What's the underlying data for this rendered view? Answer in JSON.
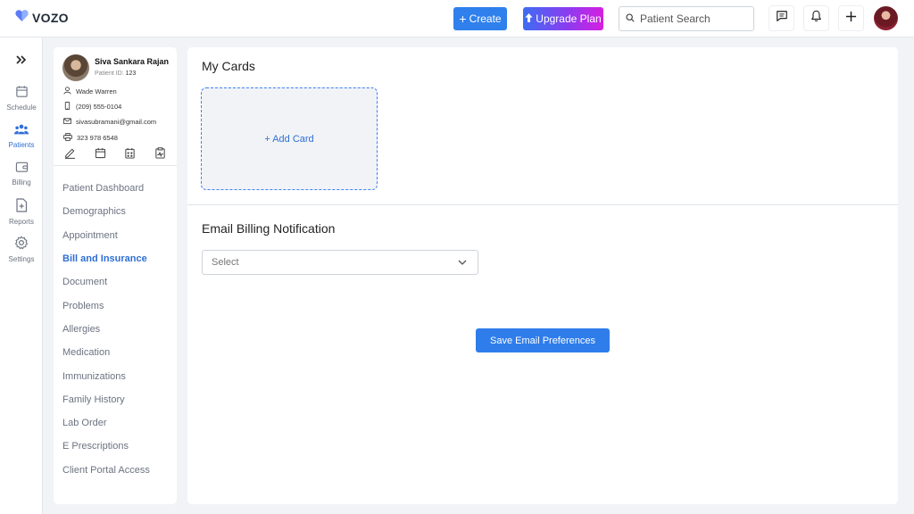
{
  "app": {
    "logo_text": "VOZO"
  },
  "header": {
    "create_label": "Create",
    "upgrade_label": "Upgrade Plan",
    "search_placeholder": "Patient Search"
  },
  "leftnav": {
    "items": [
      {
        "label": "Schedule",
        "icon": "calendar-icon"
      },
      {
        "label": "Patients",
        "icon": "patients-icon",
        "active": true
      },
      {
        "label": "Billing",
        "icon": "wallet-icon"
      },
      {
        "label": "Reports",
        "icon": "report-icon"
      },
      {
        "label": "Settings",
        "icon": "gear-icon"
      }
    ]
  },
  "patient": {
    "name": "Siva Sankara Rajan",
    "id_label": "Patient ID:",
    "id_value": "123",
    "provider": "Wade Warren",
    "phone": "(209) 555-0104",
    "email": "sivasubramani@gmail.com",
    "fax": "323 978 6548"
  },
  "patient_menu": {
    "items": [
      "Patient Dashboard",
      "Demographics",
      "Appointment",
      "Bill and Insurance",
      "Document",
      "Problems",
      "Allergies",
      "Medication",
      "Immunizations",
      "Family History",
      "Lab Order",
      "E Prescriptions",
      "Client Portal Access"
    ],
    "active": "Bill and Insurance"
  },
  "main": {
    "cards_title": "My Cards",
    "add_card_label": "+ Add Card",
    "email_title": "Email Billing Notification",
    "select_placeholder": "Select",
    "save_label": "Save Email Preferences"
  },
  "colors": {
    "accent": "#2f80ed",
    "active_text": "#2f6fd6",
    "upgrade_gradient": [
      "#3d6df2",
      "#8b3cf0",
      "#d61fe0"
    ],
    "background": "#f1f3f6"
  }
}
